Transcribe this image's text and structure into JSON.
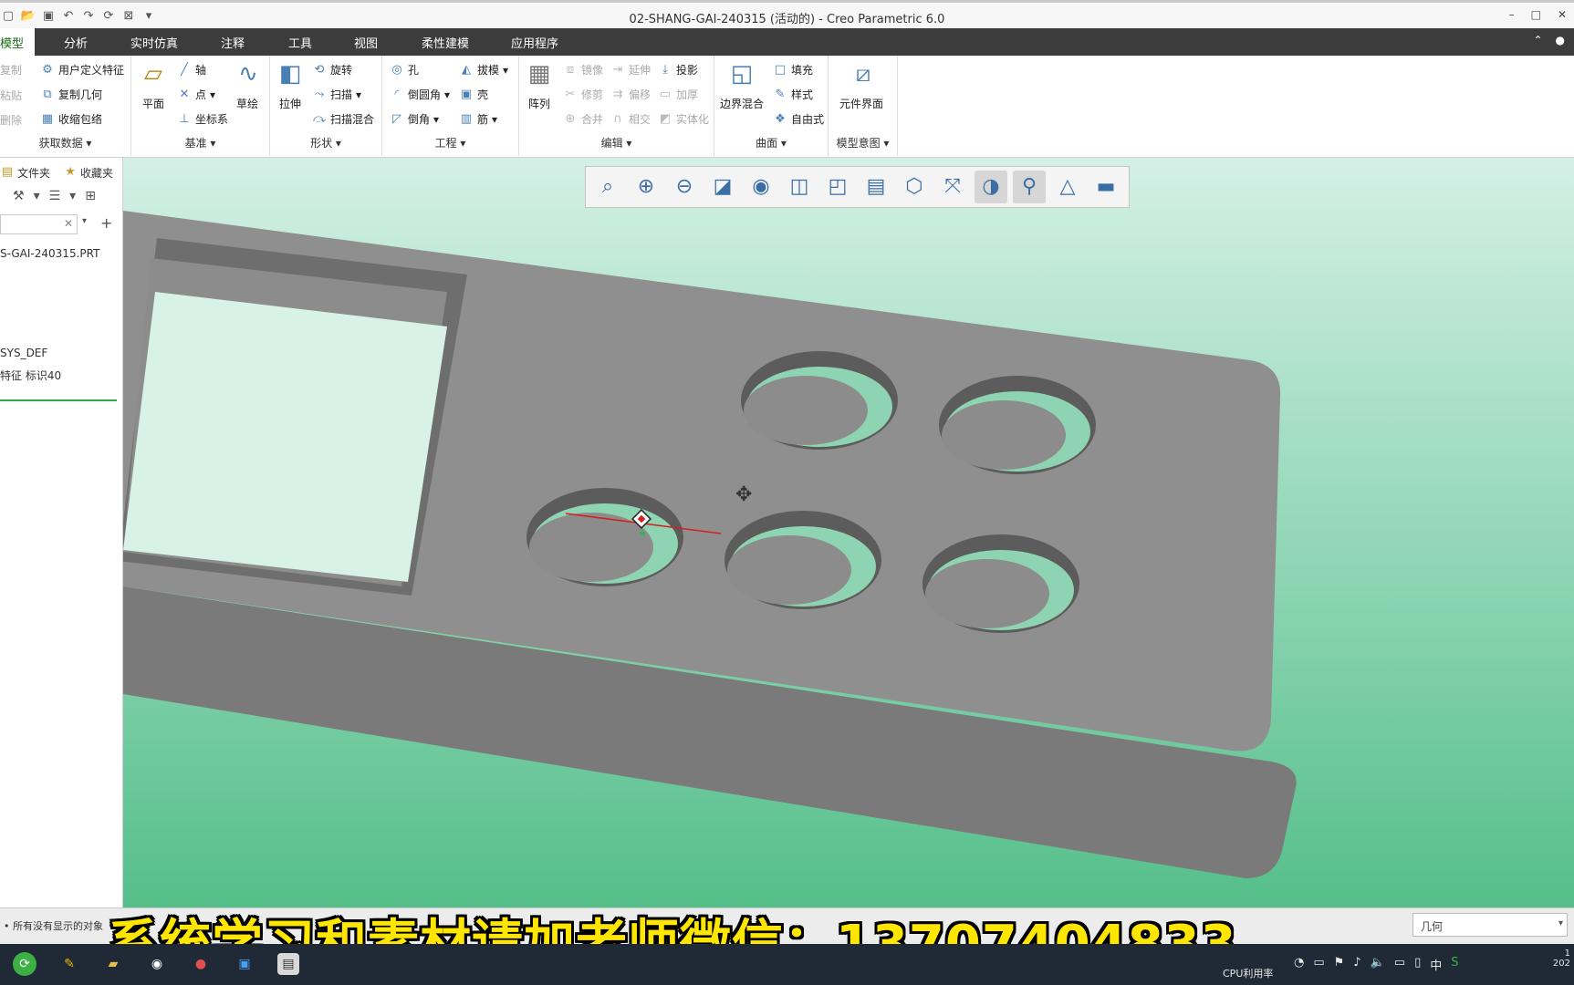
{
  "window": {
    "title": "02-SHANG-GAI-240315 (活动的) - Creo Parametric 6.0",
    "qat_icons": [
      "new-icon",
      "open-icon",
      "save-icon",
      "undo-icon",
      "redo-icon",
      "regenerate-icon",
      "close-window-icon",
      "customize-icon"
    ],
    "controls": [
      "–",
      "□",
      "✕"
    ]
  },
  "menu": {
    "tabs": [
      "模型",
      "分析",
      "实时仿真",
      "注释",
      "工具",
      "视图",
      "柔性建模",
      "应用程序"
    ],
    "active": "模型"
  },
  "ribbon": {
    "groups": {
      "get_data": {
        "label": "获取数据",
        "items": [
          "用户定义特征",
          "复制几何",
          "收缩包络"
        ],
        "left_items": [
          "复制",
          "粘贴",
          "删除"
        ]
      },
      "datum": {
        "label": "基准",
        "plane": "平面",
        "axis": "轴",
        "point": "点",
        "csys": "坐标系",
        "sketch": "草绘"
      },
      "shapes": {
        "label": "形状",
        "extrude": "拉伸",
        "revolve": "旋转",
        "sweep": "扫描",
        "swept_blend": "扫描混合"
      },
      "engineering": {
        "label": "工程",
        "hole": "孔",
        "round": "倒圆角",
        "chamfer": "倒角",
        "draft": "拔模",
        "shell": "壳",
        "rib": "筋"
      },
      "editing": {
        "label": "编辑",
        "pattern": "阵列",
        "mirror": "镜像",
        "trim": "修剪",
        "merge": "合并",
        "extend": "延伸",
        "offset": "偏移",
        "intersect": "相交",
        "project": "投影",
        "thicken": "加厚",
        "solidify": "实体化"
      },
      "surfaces": {
        "label": "曲面",
        "boundary_blend": "边界混合",
        "fill": "填充",
        "style": "样式",
        "freestyle": "自由式"
      },
      "model_intent": {
        "label": "模型意图",
        "component_interface": "元件界面"
      }
    }
  },
  "left_panel": {
    "tabs": [
      "文件夹",
      "收藏夹"
    ],
    "tree": [
      "S-GAI-240315.PRT",
      "SYS_DEF",
      "特征 标识40"
    ]
  },
  "status": {
    "message": "所有没有显示的对象",
    "filter": "几何"
  },
  "caption": "系统学习和素材请加老师微信：13707404833",
  "taskbar": {
    "cpu_label": "CPU利用率",
    "ime": "中"
  },
  "colors": {
    "menubar": "#3c3c3c",
    "active_tab_text": "#1a6e1a",
    "viewport_bg_top": "#cfeee4",
    "viewport_bg_bottom": "#5ac18e",
    "part": "#8f8f8f",
    "caption": "#ffe600"
  }
}
